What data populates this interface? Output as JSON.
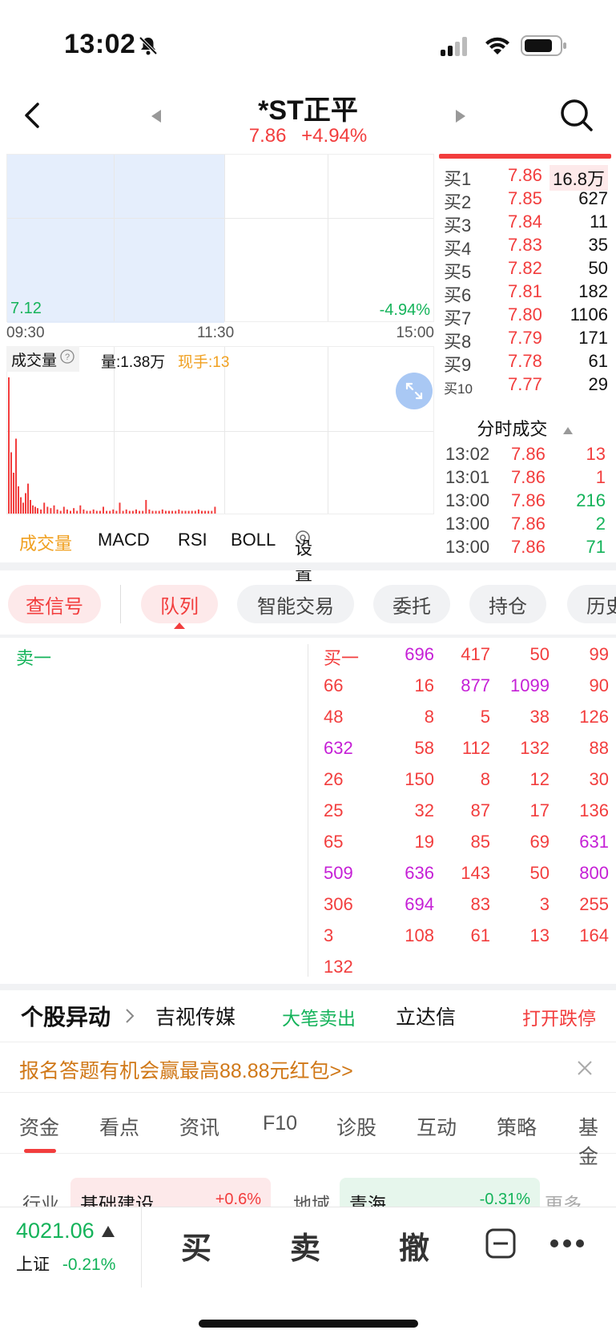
{
  "status": {
    "time": "13:02"
  },
  "header": {
    "title": "*ST正平",
    "price": "7.86",
    "change_pct": "+4.94%"
  },
  "chart": {
    "low_price": "7.12",
    "low_pct": "-4.94%",
    "time_axis": [
      "09:30",
      "11:30",
      "15:00"
    ],
    "volume_label": "成交量",
    "volume_total": "量:1.38万",
    "current_hand": "现手:13",
    "volume_bars": [
      1.0,
      0.45,
      0.3,
      0.55,
      0.2,
      0.12,
      0.08,
      0.15,
      0.22,
      0.1,
      0.06,
      0.05,
      0.04,
      0.03,
      0.08,
      0.05,
      0.04,
      0.06,
      0.03,
      0.02,
      0.05,
      0.03,
      0.02,
      0.04,
      0.02,
      0.06,
      0.03,
      0.02,
      0.02,
      0.03,
      0.02,
      0.02,
      0.05,
      0.02,
      0.02,
      0.03,
      0.02,
      0.08,
      0.02,
      0.03,
      0.02,
      0.02,
      0.03,
      0.02,
      0.02,
      0.1,
      0.03,
      0.02,
      0.02,
      0.02,
      0.03,
      0.02,
      0.02,
      0.02,
      0.02,
      0.03,
      0.02,
      0.02,
      0.02,
      0.02,
      0.02,
      0.03,
      0.02,
      0.02,
      0.02,
      0.02,
      0.05
    ]
  },
  "indicator_tabs": [
    "成交量",
    "MACD",
    "RSI",
    "BOLL",
    "设置"
  ],
  "order_book": [
    {
      "label": "买1",
      "price": "7.86",
      "volume": "16.8万"
    },
    {
      "label": "买2",
      "price": "7.85",
      "volume": "627"
    },
    {
      "label": "买3",
      "price": "7.84",
      "volume": "11"
    },
    {
      "label": "买4",
      "price": "7.83",
      "volume": "35"
    },
    {
      "label": "买5",
      "price": "7.82",
      "volume": "50"
    },
    {
      "label": "买6",
      "price": "7.81",
      "volume": "182"
    },
    {
      "label": "买7",
      "price": "7.80",
      "volume": "1106"
    },
    {
      "label": "买8",
      "price": "7.79",
      "volume": "171"
    },
    {
      "label": "买9",
      "price": "7.78",
      "volume": "61"
    },
    {
      "label": "买10",
      "price": "7.77",
      "volume": "29"
    }
  ],
  "ticks": {
    "title": "分时成交",
    "rows": [
      {
        "time": "13:02",
        "price": "7.86",
        "vol": "13",
        "dir": "red"
      },
      {
        "time": "13:01",
        "price": "7.86",
        "vol": "1",
        "dir": "red"
      },
      {
        "time": "13:00",
        "price": "7.86",
        "vol": "216",
        "dir": "green"
      },
      {
        "time": "13:00",
        "price": "7.86",
        "vol": "2",
        "dir": "green"
      },
      {
        "time": "13:00",
        "price": "7.86",
        "vol": "71",
        "dir": "green"
      }
    ]
  },
  "tabs": [
    "查信号",
    "队列",
    "智能交易",
    "委托",
    "持仓",
    "历史"
  ],
  "queue": {
    "sell_label": "卖一",
    "buy_label": "买一",
    "rows": [
      [
        null,
        "696",
        "417",
        "50",
        "99"
      ],
      [
        "66",
        "16",
        "877",
        "1099",
        "90"
      ],
      [
        "48",
        "8",
        "5",
        "38",
        "126"
      ],
      [
        "632",
        "58",
        "112",
        "132",
        "88"
      ],
      [
        "26",
        "150",
        "8",
        "12",
        "30"
      ],
      [
        "25",
        "32",
        "87",
        "17",
        "136"
      ],
      [
        "65",
        "19",
        "85",
        "69",
        "631"
      ],
      [
        "509",
        "636",
        "143",
        "50",
        "800"
      ],
      [
        "306",
        "694",
        "83",
        "3",
        "255"
      ],
      [
        "3",
        "108",
        "61",
        "13",
        "164"
      ],
      [
        "132",
        null,
        null,
        null,
        null
      ]
    ],
    "big_values": [
      "696",
      "877",
      "1099",
      "632",
      "631",
      "509",
      "636",
      "800",
      "694"
    ]
  },
  "alert": {
    "title": "个股异动",
    "stock1": "吉视传媒",
    "event1": "大笔卖出",
    "stock2": "立达信",
    "event2": "打开跌停"
  },
  "promo": {
    "text": "报名答题有机会赢最高88.88元红包>>"
  },
  "nav_tabs": [
    "资金",
    "看点",
    "资讯",
    "F10",
    "诊股",
    "互动",
    "策略",
    "基金"
  ],
  "sector": {
    "label1": "行业",
    "name1": "基础建设",
    "val1": "+0.6%",
    "label2": "地域",
    "name2": "青海",
    "val2": "-0.31%",
    "more": "更多"
  },
  "bottom": {
    "index_value": "4021.06",
    "index_name": "上证",
    "index_change": "-0.21%",
    "buy": "买",
    "sell": "卖",
    "cancel": "撤"
  },
  "colors": {
    "up": "#f23d3d",
    "down": "#14b35a",
    "big": "#c51fd6",
    "accent": "#f0a020"
  }
}
